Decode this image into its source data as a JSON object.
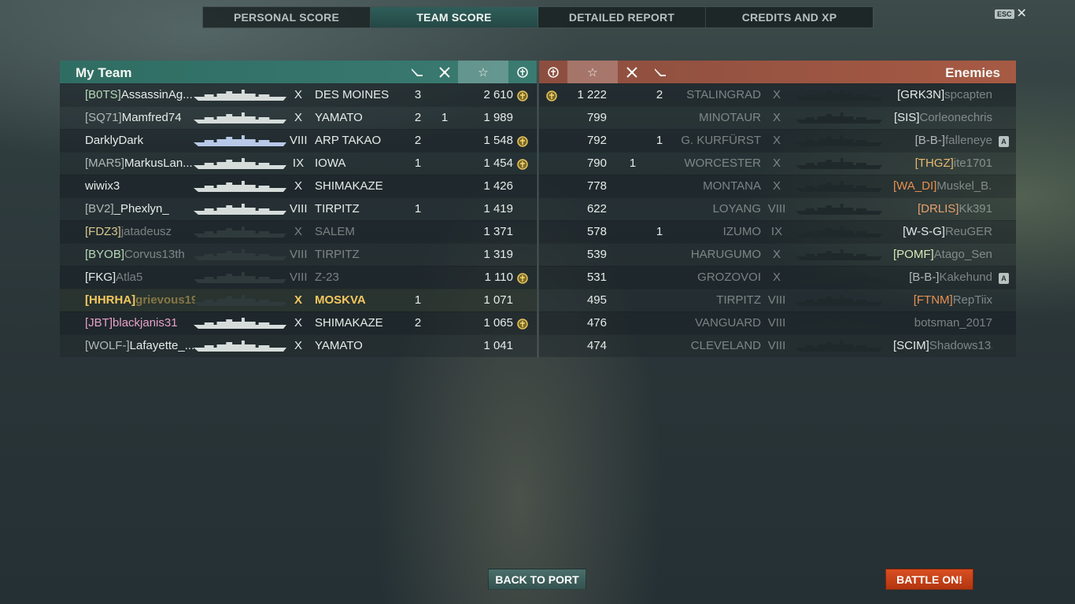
{
  "tabs": [
    {
      "label": "PERSONAL SCORE",
      "active": false
    },
    {
      "label": "TEAM SCORE",
      "active": true
    },
    {
      "label": "DETAILED REPORT",
      "active": false
    },
    {
      "label": "CREDITS AND XP",
      "active": false
    }
  ],
  "close": {
    "key_label": "ESC",
    "icon": "close-icon"
  },
  "my_team": {
    "title": "My Team",
    "header_icons": [
      "torpedo-icon",
      "plane-kill-icon",
      "star-icon",
      "ribbon-icon"
    ],
    "rows": [
      {
        "clan": "[B0TS]",
        "name": "AssassinAg...",
        "tier": "X",
        "ship": "DES MOINES",
        "c1": "3",
        "c2": "",
        "score": "2 610",
        "ribbon": true,
        "clan_color": "#b8d8b8",
        "name_color": "#e6ece9",
        "highlight": false
      },
      {
        "clan": "[SQ71]",
        "name": "Mamfred74",
        "tier": "X",
        "ship": "YAMATO",
        "c1": "2",
        "c2": "1",
        "score": "1 989",
        "ribbon": false,
        "clan_color": "#b0b8b6",
        "name_color": "#e6ece9",
        "highlight": false
      },
      {
        "clan": "",
        "name": "DarklyDark",
        "tier": "VIII",
        "ship": "ARP TAKAO",
        "c1": "2",
        "c2": "",
        "score": "1 548",
        "ribbon": true,
        "clan_color": "#b0b8b6",
        "name_color": "#e6ece9",
        "highlight": false
      },
      {
        "clan": "[MAR5]",
        "name": "MarkusLan...",
        "tier": "IX",
        "ship": "IOWA",
        "c1": "1",
        "c2": "",
        "score": "1 454",
        "ribbon": true,
        "clan_color": "#b0b8b6",
        "name_color": "#e6ece9",
        "highlight": false
      },
      {
        "clan": "",
        "name": "wiwix3",
        "tier": "X",
        "ship": "SHIMAKAZE",
        "c1": "",
        "c2": "",
        "score": "1 426",
        "ribbon": false,
        "clan_color": "#b0b8b6",
        "name_color": "#e6ece9",
        "highlight": false
      },
      {
        "clan": "[BV2]",
        "name": "_Phexlyn_",
        "tier": "VIII",
        "ship": "TIRPITZ",
        "c1": "1",
        "c2": "",
        "score": "1 419",
        "ribbon": false,
        "clan_color": "#b0b8b6",
        "name_color": "#e6ece9",
        "highlight": false
      },
      {
        "clan": "[FDZ3]",
        "name": "jatadeusz",
        "tier": "X",
        "ship": "SALEM",
        "c1": "",
        "c2": "",
        "score": "1 371",
        "ribbon": false,
        "clan_color": "#d8c890",
        "name_color": "#e6ece9",
        "highlight": false,
        "dead": true
      },
      {
        "clan": "[BYOB]",
        "name": "Corvus13th",
        "tier": "VIII",
        "ship": "TIRPITZ",
        "c1": "",
        "c2": "",
        "score": "1 319",
        "ribbon": false,
        "clan_color": "#b8d8b8",
        "name_color": "#e6ece9",
        "highlight": false,
        "dead": true
      },
      {
        "clan": "[FKG]",
        "name": "Atla5",
        "tier": "VIII",
        "ship": "Z-23",
        "c1": "",
        "c2": "",
        "score": "1 110",
        "ribbon": true,
        "clan_color": "#e6ece9",
        "name_color": "#e6ece9",
        "highlight": false,
        "dead": true
      },
      {
        "clan": "[HHRHA]",
        "name": "grievous19...",
        "tier": "X",
        "ship": "MOSKVA",
        "c1": "1",
        "c2": "",
        "score": "1 071",
        "ribbon": false,
        "clan_color": "#f4c860",
        "name_color": "#f4c860",
        "highlight": true,
        "dead": true
      },
      {
        "clan": "[JBT]",
        "name": "blackjanis31",
        "tier": "X",
        "ship": "SHIMAKAZE",
        "c1": "2",
        "c2": "",
        "score": "1 065",
        "ribbon": true,
        "clan_color": "#e8a0c8",
        "name_color": "#e8a0c8",
        "highlight": false
      },
      {
        "clan": "[WOLF-]",
        "name": "Lafayette_...",
        "tier": "X",
        "ship": "YAMATO",
        "c1": "",
        "c2": "",
        "score": "1 041",
        "ribbon": false,
        "clan_color": "#b0b8b6",
        "name_color": "#e6ece9",
        "highlight": false
      }
    ]
  },
  "enemies": {
    "title": "Enemies",
    "header_icons": [
      "ribbon-icon",
      "star-icon",
      "plane-kill-icon",
      "torpedo-icon"
    ],
    "rows": [
      {
        "clan": "[GRK3N]",
        "name": "spcapten",
        "tier": "X",
        "ship": "STALINGRAD",
        "c1": "",
        "c2": "2",
        "score": "1 222",
        "ribbon": true,
        "clan_color": "#e6ece9",
        "badge": ""
      },
      {
        "clan": "[SIS]",
        "name": "Corleonechris",
        "tier": "X",
        "ship": "MINOTAUR",
        "c1": "",
        "c2": "",
        "score": "799",
        "ribbon": false,
        "clan_color": "#e6ece9",
        "badge": ""
      },
      {
        "clan": "[B-B-]",
        "name": "falleneye",
        "tier": "X",
        "ship": "G. KURFÜRST",
        "c1": "",
        "c2": "1",
        "score": "792",
        "ribbon": false,
        "clan_color": "#b0b8b6",
        "badge": "A"
      },
      {
        "clan": "[THGZ]",
        "name": "ite1701",
        "tier": "X",
        "ship": "WORCESTER",
        "c1": "1",
        "c2": "",
        "score": "790",
        "ribbon": false,
        "clan_color": "#e8b870",
        "badge": ""
      },
      {
        "clan": "[WA_DI]",
        "name": "Muskel_B...",
        "tier": "X",
        "ship": "MONTANA",
        "c1": "",
        "c2": "",
        "score": "778",
        "ribbon": false,
        "clan_color": "#e89050",
        "badge": ""
      },
      {
        "clan": "[DRLIS]",
        "name": "Kk391",
        "tier": "VIII",
        "ship": "LOYANG",
        "c1": "",
        "c2": "",
        "score": "622",
        "ribbon": false,
        "clan_color": "#e8a070",
        "badge": ""
      },
      {
        "clan": "[W-S-G]",
        "name": "ReuGER",
        "tier": "IX",
        "ship": "IZUMO",
        "c1": "",
        "c2": "1",
        "score": "578",
        "ribbon": false,
        "clan_color": "#e6ece9",
        "badge": ""
      },
      {
        "clan": "[POMF]",
        "name": "Atago_Sen...",
        "tier": "X",
        "ship": "HARUGUMO",
        "c1": "",
        "c2": "",
        "score": "539",
        "ribbon": false,
        "clan_color": "#d8e8b8",
        "badge": ""
      },
      {
        "clan": "[B-B-]",
        "name": "Kakehund",
        "tier": "X",
        "ship": "GROZOVOI",
        "c1": "",
        "c2": "",
        "score": "531",
        "ribbon": false,
        "clan_color": "#b0b8b6",
        "badge": "A"
      },
      {
        "clan": "[FTNM]",
        "name": "RepTiix",
        "tier": "VIII",
        "ship": "TIRPITZ",
        "c1": "",
        "c2": "",
        "score": "495",
        "ribbon": false,
        "clan_color": "#e89050",
        "badge": ""
      },
      {
        "clan": "",
        "name": "botsman_2017",
        "tier": "VIII",
        "ship": "VANGUARD",
        "c1": "",
        "c2": "",
        "score": "476",
        "ribbon": false,
        "clan_color": "#b0b8b6",
        "badge": ""
      },
      {
        "clan": "[SCIM]",
        "name": "Shadows13...",
        "tier": "VIII",
        "ship": "CLEVELAND",
        "c1": "",
        "c2": "",
        "score": "474",
        "ribbon": false,
        "clan_color": "#e6ece9",
        "badge": ""
      }
    ]
  },
  "buttons": {
    "back": "BACK TO PORT",
    "battle": "BATTLE ON!"
  },
  "colors": {
    "team_header": "#2f6d63",
    "enemy_header": "#a65a44",
    "battle_button": "#d94f22"
  }
}
